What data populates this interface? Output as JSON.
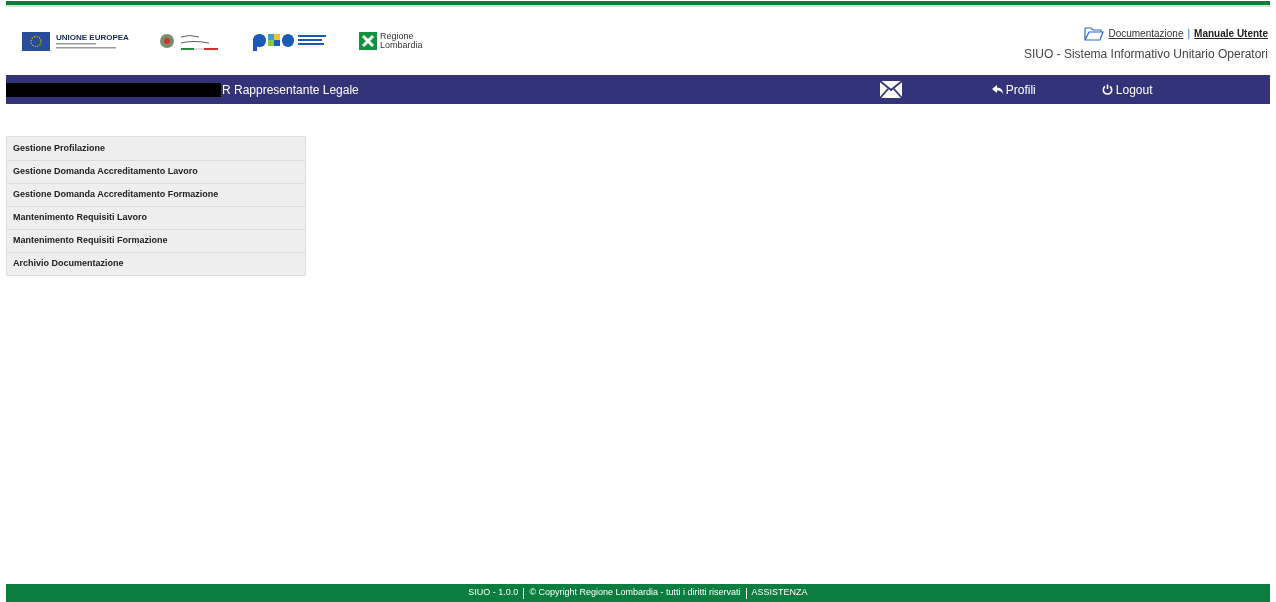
{
  "logos": {
    "eu": "UNIONE EUROPEA",
    "region": [
      "Regione",
      "Lombardia"
    ]
  },
  "header_links": {
    "documentation": "Documentazione",
    "separator": "|",
    "manual": "Manuale Utente",
    "system_name": "SIUO - Sistema Informativo Unitario Operatori"
  },
  "navbar": {
    "user_role": "R Rappresentante Legale",
    "profiles": "Profili",
    "logout": "Logout"
  },
  "menu": [
    "Gestione Profilazione",
    "Gestione Domanda Accreditamento Lavoro",
    "Gestione Domanda Accreditamento Formazione",
    "Mantenimento Requisiti Lavoro",
    "Mantenimento Requisiti Formazione",
    "Archivio Documentazione"
  ],
  "footer": {
    "version": "SIUO - 1.0.0",
    "copyright": "© Copyright Regione Lombardia - tutti i diritti riservati",
    "assistance": "ASSISTENZA"
  }
}
